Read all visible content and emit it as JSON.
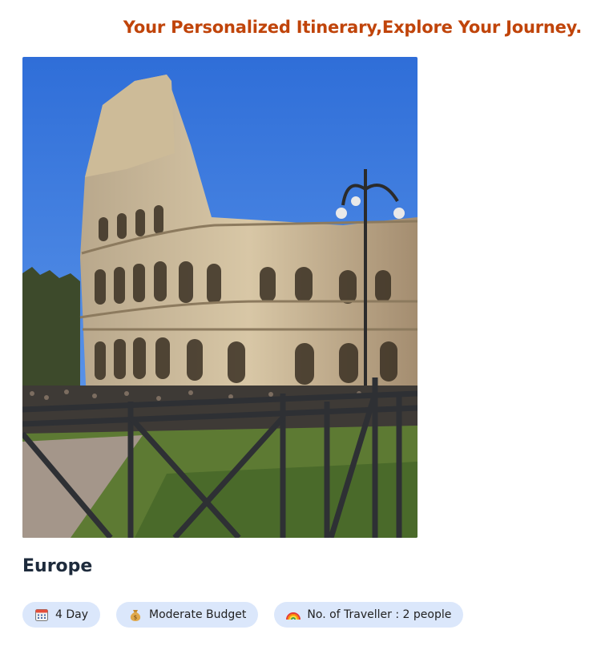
{
  "header": {
    "title": "Your Personalized Itinerary,Explore Your Journey."
  },
  "trip": {
    "destination": "Europe",
    "chips": [
      {
        "icon": "calendar-icon",
        "label": "4 Day"
      },
      {
        "icon": "money-bag-icon",
        "label": "Moderate Budget"
      },
      {
        "icon": "rainbow-icon",
        "label": "No. of Traveller : 2 people"
      }
    ]
  },
  "colors": {
    "accent": "#c0440a",
    "chip_bg": "#dbe7fb",
    "heading": "#1e2b3c"
  }
}
